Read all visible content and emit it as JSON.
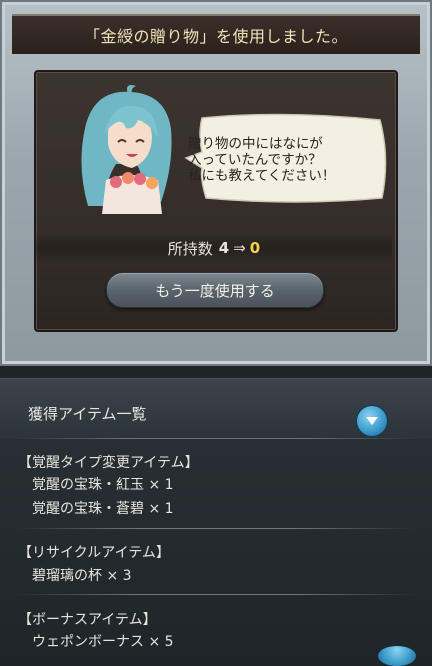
{
  "dialog": {
    "title": "「金綬の贈り物」を使用しました。",
    "speech": [
      "贈り物の中にはなにが",
      "入っていたんですか？",
      "私にも教えてください！"
    ],
    "count_label": "所持数",
    "count_from": "4",
    "count_arrow": "⇒",
    "count_to": "0",
    "reuse_button": "もう一度使用する"
  },
  "list": {
    "header": "獲得アイテム一覧",
    "categories": [
      {
        "name": "【覚醒タイプ変更アイテム】",
        "items": [
          "覚醒の宝珠・紅玉 × 1",
          "覚醒の宝珠・蒼碧 × 1"
        ]
      },
      {
        "name": "【リサイクルアイテム】",
        "items": [
          "碧瑠璃の杯 × 3"
        ]
      },
      {
        "name": "【ボーナスアイテム】",
        "items": [
          "ウェポンボーナス × 5"
        ]
      }
    ]
  },
  "icons": {
    "collapse": "chevron-down-icon",
    "character": "character-portrait",
    "bubble": "speech-bubble"
  },
  "colors": {
    "accent_count": "#f0d24a",
    "title_text": "#f1e4b8",
    "button_blue": "#3c9ccc"
  }
}
